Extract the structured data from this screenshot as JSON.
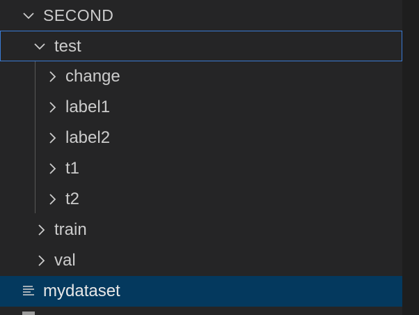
{
  "explorer": {
    "section": {
      "title": "SECOND",
      "icon": "chevron-down-icon"
    },
    "tree": [
      {
        "label": "test",
        "icon": "chevron-down-icon",
        "state": "expanded",
        "focused": true
      },
      {
        "label": "change",
        "icon": "chevron-right-icon",
        "state": "collapsed"
      },
      {
        "label": "label1",
        "icon": "chevron-right-icon",
        "state": "collapsed"
      },
      {
        "label": "label2",
        "icon": "chevron-right-icon",
        "state": "collapsed"
      },
      {
        "label": "t1",
        "icon": "chevron-right-icon",
        "state": "collapsed"
      },
      {
        "label": "t2",
        "icon": "chevron-right-icon",
        "state": "collapsed"
      },
      {
        "label": "train",
        "icon": "chevron-right-icon",
        "state": "collapsed"
      },
      {
        "label": "val",
        "icon": "chevron-right-icon",
        "state": "collapsed"
      },
      {
        "label": "mydataset",
        "icon": "text-file-icon",
        "state": "file",
        "selected": true
      }
    ]
  },
  "colors": {
    "background": "#252526",
    "text": "#cccccc",
    "focus_border": "#3a7bd5",
    "selection": "#04395e",
    "indent_guide": "#585858"
  }
}
